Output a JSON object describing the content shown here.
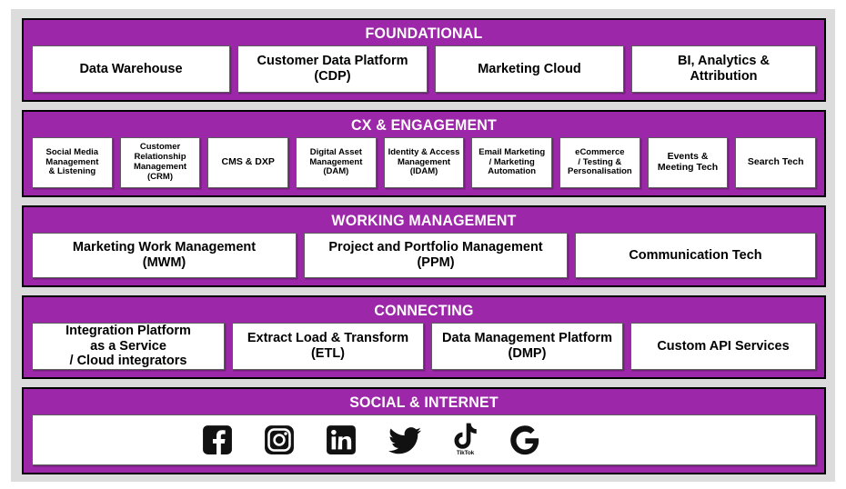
{
  "theme": {
    "band_purple": "#9C27A8",
    "band_border": "#000000",
    "panel_gray": "#DCDCDC",
    "box_white": "#FFFFFF",
    "box_border": "#5D5D5D",
    "text_black": "#000000",
    "title_white": "#FFFFFF"
  },
  "rows": [
    {
      "title": "FOUNDATIONAL",
      "boxes": [
        "Data Warehouse",
        "Customer Data Platform\n(CDP)",
        "Marketing Cloud",
        "BI, Analytics &\nAttribution"
      ]
    },
    {
      "title": "CX & ENGAGEMENT",
      "boxes": [
        "Social Media\nManagement\n& Listening",
        "Customer\nRelationship\nManagement\n(CRM)",
        "CMS & DXP",
        "Digital Asset\nManagement\n(DAM)",
        "Identity & Access\nManagement\n(IDAM)",
        "Email Marketing\n/ Marketing\nAutomation",
        "eCommerce\n/ Testing &\nPersonalisation",
        "Events &\nMeeting Tech",
        "Search Tech"
      ]
    },
    {
      "title": "WORKING MANAGEMENT",
      "boxes": [
        "Marketing Work Management\n(MWM)",
        "Project and Portfolio Management\n(PPM)",
        "Communication Tech"
      ]
    },
    {
      "title": "CONNECTING",
      "boxes": [
        "Integration Platform\nas a Service\n/ Cloud integrators",
        "Extract Load & Transform\n(ETL)",
        "Data Management Platform\n(DMP)",
        "Custom API Services"
      ]
    },
    {
      "title": "SOCIAL & INTERNET",
      "icons": [
        {
          "name": "facebook-icon",
          "label": ""
        },
        {
          "name": "instagram-icon",
          "label": ""
        },
        {
          "name": "linkedin-icon",
          "label": ""
        },
        {
          "name": "twitter-icon",
          "label": ""
        },
        {
          "name": "tiktok-icon",
          "label": "TikTok"
        },
        {
          "name": "google-icon",
          "label": ""
        }
      ]
    }
  ]
}
